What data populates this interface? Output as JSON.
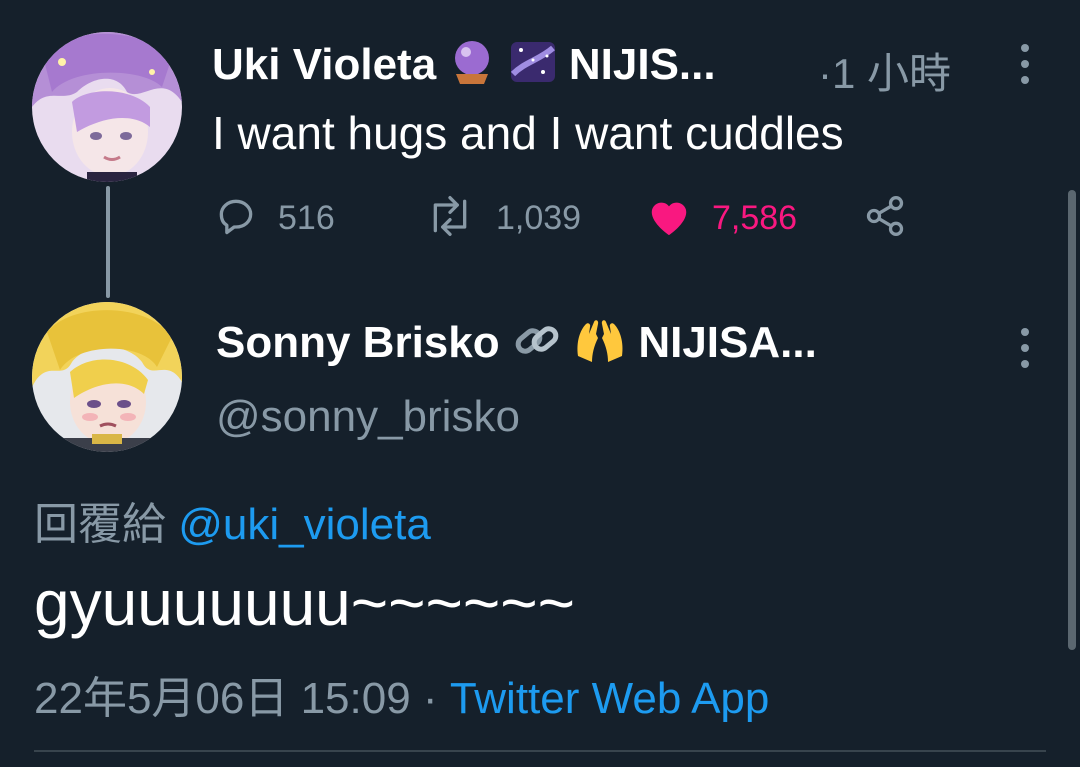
{
  "parent_tweet": {
    "display_name": "Uki Violeta",
    "emoji_icons": [
      "crystal-ball-icon",
      "milky-way-icon"
    ],
    "name_suffix": "NIJIS...",
    "time": "·1 小時",
    "text": "I want hugs and I want cuddles",
    "actions": {
      "reply_count": "516",
      "retweet_count": "1,039",
      "like_count": "7,586",
      "liked": true
    }
  },
  "reply_tweet": {
    "display_name": "Sonny Brisko",
    "emoji_icons": [
      "link-icon",
      "raising-hands-icon"
    ],
    "name_suffix": "NIJISA...",
    "handle": "@sonny_brisko",
    "reply_label": "回覆給",
    "reply_mention": "@uki_violeta",
    "text": "gyuuuuuuu~~~~~~",
    "timestamp": "22年5月06日 15:09",
    "separator": "·",
    "source": "Twitter Web App"
  },
  "colors": {
    "background": "#15202b",
    "muted": "#8899a6",
    "link": "#1d9bf0",
    "like": "#f91880"
  }
}
